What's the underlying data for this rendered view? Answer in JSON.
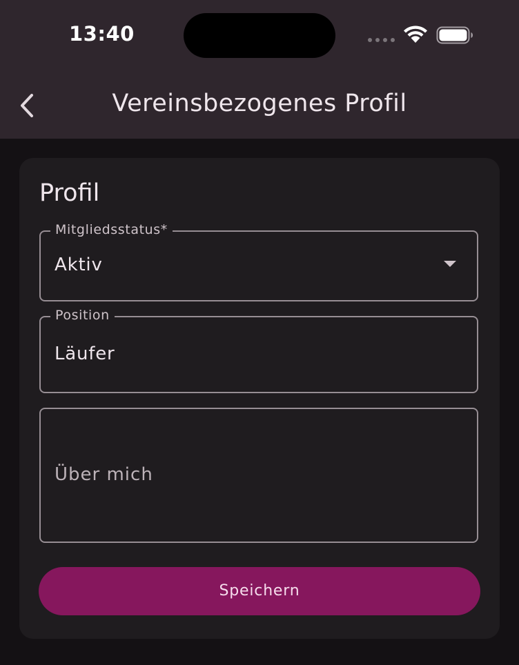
{
  "status_bar": {
    "time": "13:40",
    "icons": [
      "cellular-signal-icon",
      "wifi-icon",
      "battery-icon"
    ]
  },
  "app_bar": {
    "back_icon": "chevron-left-icon",
    "title": "Vereinsbezogenes Profil"
  },
  "card": {
    "title": "Profil",
    "member_status": {
      "label": "Mitgliedsstatus*",
      "value": "Aktiv",
      "icon": "dropdown-arrow-icon"
    },
    "position": {
      "label": "Position",
      "value": "Läufer"
    },
    "about": {
      "placeholder": "Über mich",
      "value": ""
    },
    "save_label": "Speichern"
  },
  "colors": {
    "app_bar_bg": "#2f262d",
    "background": "#141114",
    "card_bg": "#1f1c1f",
    "accent": "#86175d",
    "outline": "#978e94"
  }
}
